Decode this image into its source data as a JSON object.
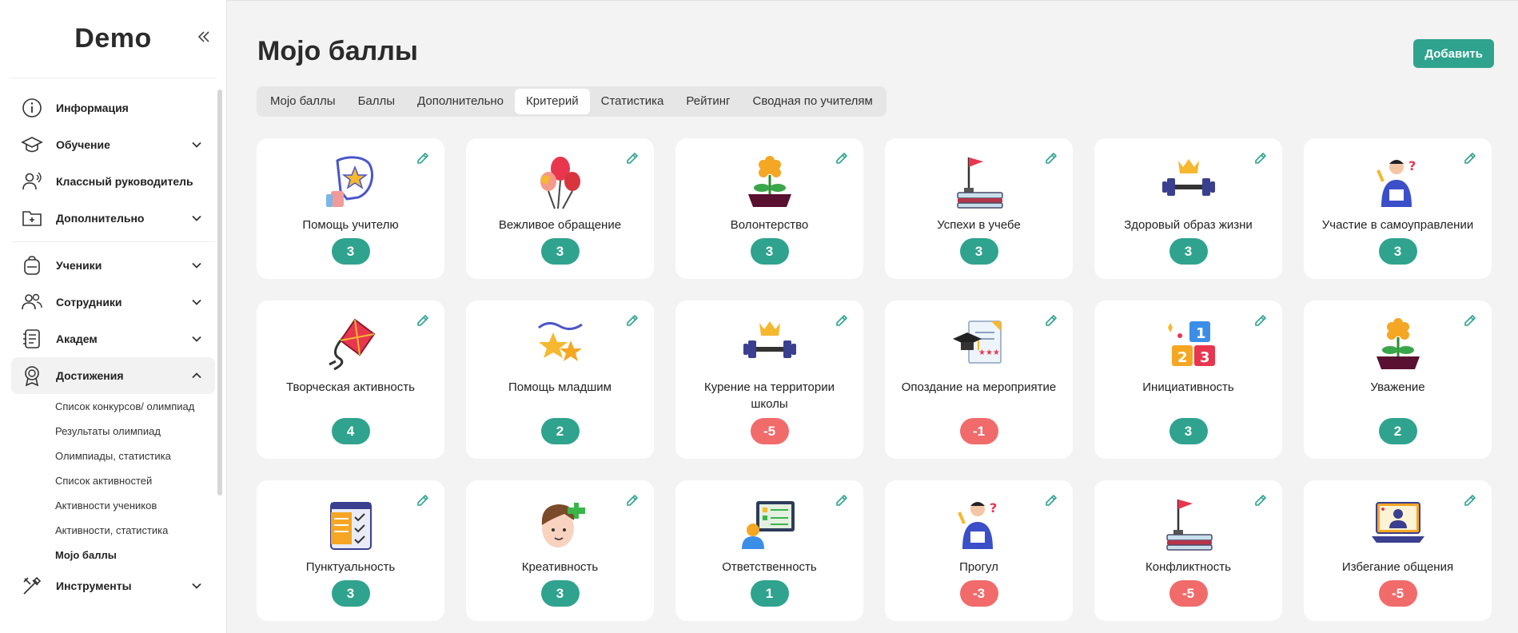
{
  "sidebar": {
    "logo": "Demo",
    "items": [
      {
        "label": "Информация",
        "icon": "info-icon",
        "chevron": false
      },
      {
        "label": "Обучение",
        "icon": "graduation-cap-icon",
        "chevron": true
      },
      {
        "label": "Классный руководитель",
        "icon": "teacher-icon",
        "chevron": false
      },
      {
        "label": "Дополнительно",
        "icon": "folder-plus-icon",
        "chevron": true
      },
      {
        "label": "Ученики",
        "icon": "backpack-icon",
        "chevron": true
      },
      {
        "label": "Сотрудники",
        "icon": "users-icon",
        "chevron": true
      },
      {
        "label": "Академ",
        "icon": "notebook-icon",
        "chevron": true
      },
      {
        "label": "Достижения",
        "icon": "award-icon",
        "chevron": true
      },
      {
        "label": "Инструменты",
        "icon": "tools-icon",
        "chevron": true
      }
    ],
    "sub_items": [
      "Список конкурсов/ олимпиад",
      "Результаты олимпиад",
      "Олимпиады, статистика",
      "Список активностей",
      "Активности учеников",
      "Активности, статистика",
      "Mojo баллы"
    ]
  },
  "header": {
    "title": "Mojo баллы",
    "add_label": "Добавить"
  },
  "tabs": [
    "Mojo баллы",
    "Баллы",
    "Дополнительно",
    "Критерий",
    "Статистика",
    "Рейтинг",
    "Сводная по учителям"
  ],
  "active_tab": "Критерий",
  "criteria": [
    {
      "title": "Помощь учителю",
      "score": "3",
      "icon": "hand-star-icon"
    },
    {
      "title": "Вежливое обращение",
      "score": "3",
      "icon": "balloons-icon"
    },
    {
      "title": "Волонтерство",
      "score": "3",
      "icon": "flower-pot-icon"
    },
    {
      "title": "Успехи в учебе",
      "score": "3",
      "icon": "books-flag-icon"
    },
    {
      "title": "Здоровый образ жизни",
      "score": "3",
      "icon": "dumbbell-crown-icon"
    },
    {
      "title": "Участие в самоуправлении",
      "score": "3",
      "icon": "student-question-icon"
    },
    {
      "title": "Творческая активность",
      "score": "4",
      "icon": "kite-icon"
    },
    {
      "title": "Помощь младшим",
      "score": "2",
      "icon": "stars-icon"
    },
    {
      "title": "Курение на территории школы",
      "score": "-5",
      "icon": "dumbbell-crown-icon"
    },
    {
      "title": "Опоздание на мероприятие",
      "score": "-1",
      "icon": "certificate-cap-icon"
    },
    {
      "title": "Инициативность",
      "score": "3",
      "icon": "number-blocks-icon"
    },
    {
      "title": "Уважение",
      "score": "2",
      "icon": "flower-pot-icon"
    },
    {
      "title": "Пунктуальность",
      "score": "3",
      "icon": "checklist-icon"
    },
    {
      "title": "Креативность",
      "score": "3",
      "icon": "boy-puzzle-icon"
    },
    {
      "title": "Ответственность",
      "score": "1",
      "icon": "presentation-icon"
    },
    {
      "title": "Прогул",
      "score": "-3",
      "icon": "student-question-icon"
    },
    {
      "title": "Конфликтность",
      "score": "-5",
      "icon": "books-flag-icon"
    },
    {
      "title": "Избегание общения",
      "score": "-5",
      "icon": "laptop-user-icon"
    }
  ],
  "colors": {
    "accent": "#2fa38e",
    "negative": "#f16b6b"
  }
}
